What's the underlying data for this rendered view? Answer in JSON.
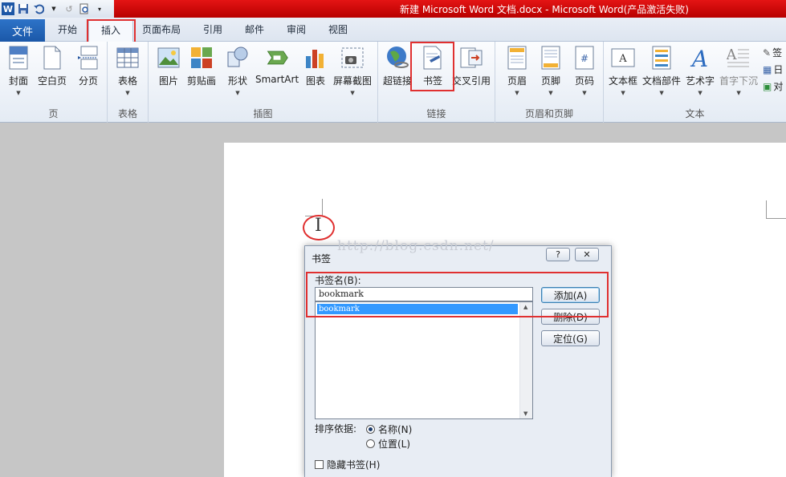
{
  "title_bar": {
    "title": "新建 Microsoft Word 文档.docx  -  Microsoft Word(产品激活失败)"
  },
  "quick_access": {
    "app_icon": "W",
    "icons": [
      "save-icon",
      "undo-icon",
      "redo-icon",
      "print-preview-icon",
      "customize-qat-icon"
    ]
  },
  "tabs": {
    "file": "文件",
    "home": "开始",
    "insert": "插入",
    "layout": "页面布局",
    "references": "引用",
    "mailings": "邮件",
    "review": "审阅",
    "view": "视图"
  },
  "ribbon": {
    "groups": {
      "pages": "页",
      "tables": "表格",
      "illustrations": "插图",
      "links": "链接",
      "header_footer": "页眉和页脚",
      "text": "文本"
    },
    "buttons": {
      "cover": "封面",
      "blank_page": "空白页",
      "page_break": "分页",
      "table": "表格",
      "picture": "图片",
      "clipart": "剪贴画",
      "shapes": "形状",
      "smartart": "SmartArt",
      "chart": "图表",
      "screenshot": "屏幕截图",
      "hyperlink": "超链接",
      "bookmark": "书签",
      "cross_ref": "交叉引用",
      "header": "页眉",
      "footer": "页脚",
      "page_number": "页码",
      "textbox": "文本框",
      "quick_parts": "文档部件",
      "wordart": "艺术字",
      "dropcap": "首字下沉"
    },
    "small": [
      "签",
      "日",
      "对"
    ]
  },
  "document": {
    "watermark": "http://blog.csdn.net/",
    "cursor": "I"
  },
  "dialog": {
    "title": "书签",
    "help": "?",
    "close": "✕",
    "name_label": "书签名(B):",
    "name_value": "bookmark",
    "list_items": [
      "bookmark"
    ],
    "add": "添加(A)",
    "delete": "删除(D)",
    "goto": "定位(G)",
    "sort_label": "排序依据:",
    "sort_name": "名称(N)",
    "sort_location": "位置(L)",
    "hidden": "隐藏书签(H)"
  }
}
